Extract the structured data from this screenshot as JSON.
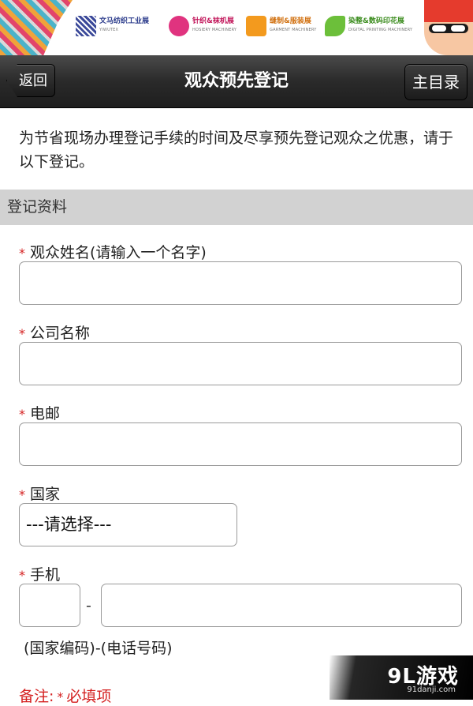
{
  "banner": {
    "logos": [
      {
        "name": "文马纺织工业展",
        "sub": "YIWUTEX"
      },
      {
        "name": "针织&袜机展",
        "sub": "HOSIERY MACHINERY"
      },
      {
        "name": "缝制&服装展",
        "sub": "GARMENT MACHINERY"
      },
      {
        "name": "染整&数码印花展",
        "sub": "DIGITAL PRINTING MACHINERY"
      }
    ]
  },
  "navbar": {
    "back_label": "返回",
    "title": "观众预先登记",
    "menu_label": "主目录"
  },
  "intro": "为节省现场办理登记手续的时间及尽享预先登记观众之优惠，请于以下登记。",
  "section_title": "登记资料",
  "form": {
    "required_mark": "*",
    "name_label": "观众姓名(请输入一个名字)",
    "company_label": "公司名称",
    "email_label": "电邮",
    "country_label": "国家",
    "country_value": "---请选择---",
    "mobile_label": "手机",
    "phone_separator": "-",
    "phone_hint": "(国家编码)-(电话号码)"
  },
  "note": {
    "prefix": "备注:",
    "mark": "*",
    "suffix": "必填项"
  },
  "watermark": {
    "brand": "9L游戏",
    "site": "91danji.com"
  },
  "colors": {
    "required": "#d42020",
    "navbar": "#2a2a2a",
    "section_bar": "#d2d2d2"
  }
}
